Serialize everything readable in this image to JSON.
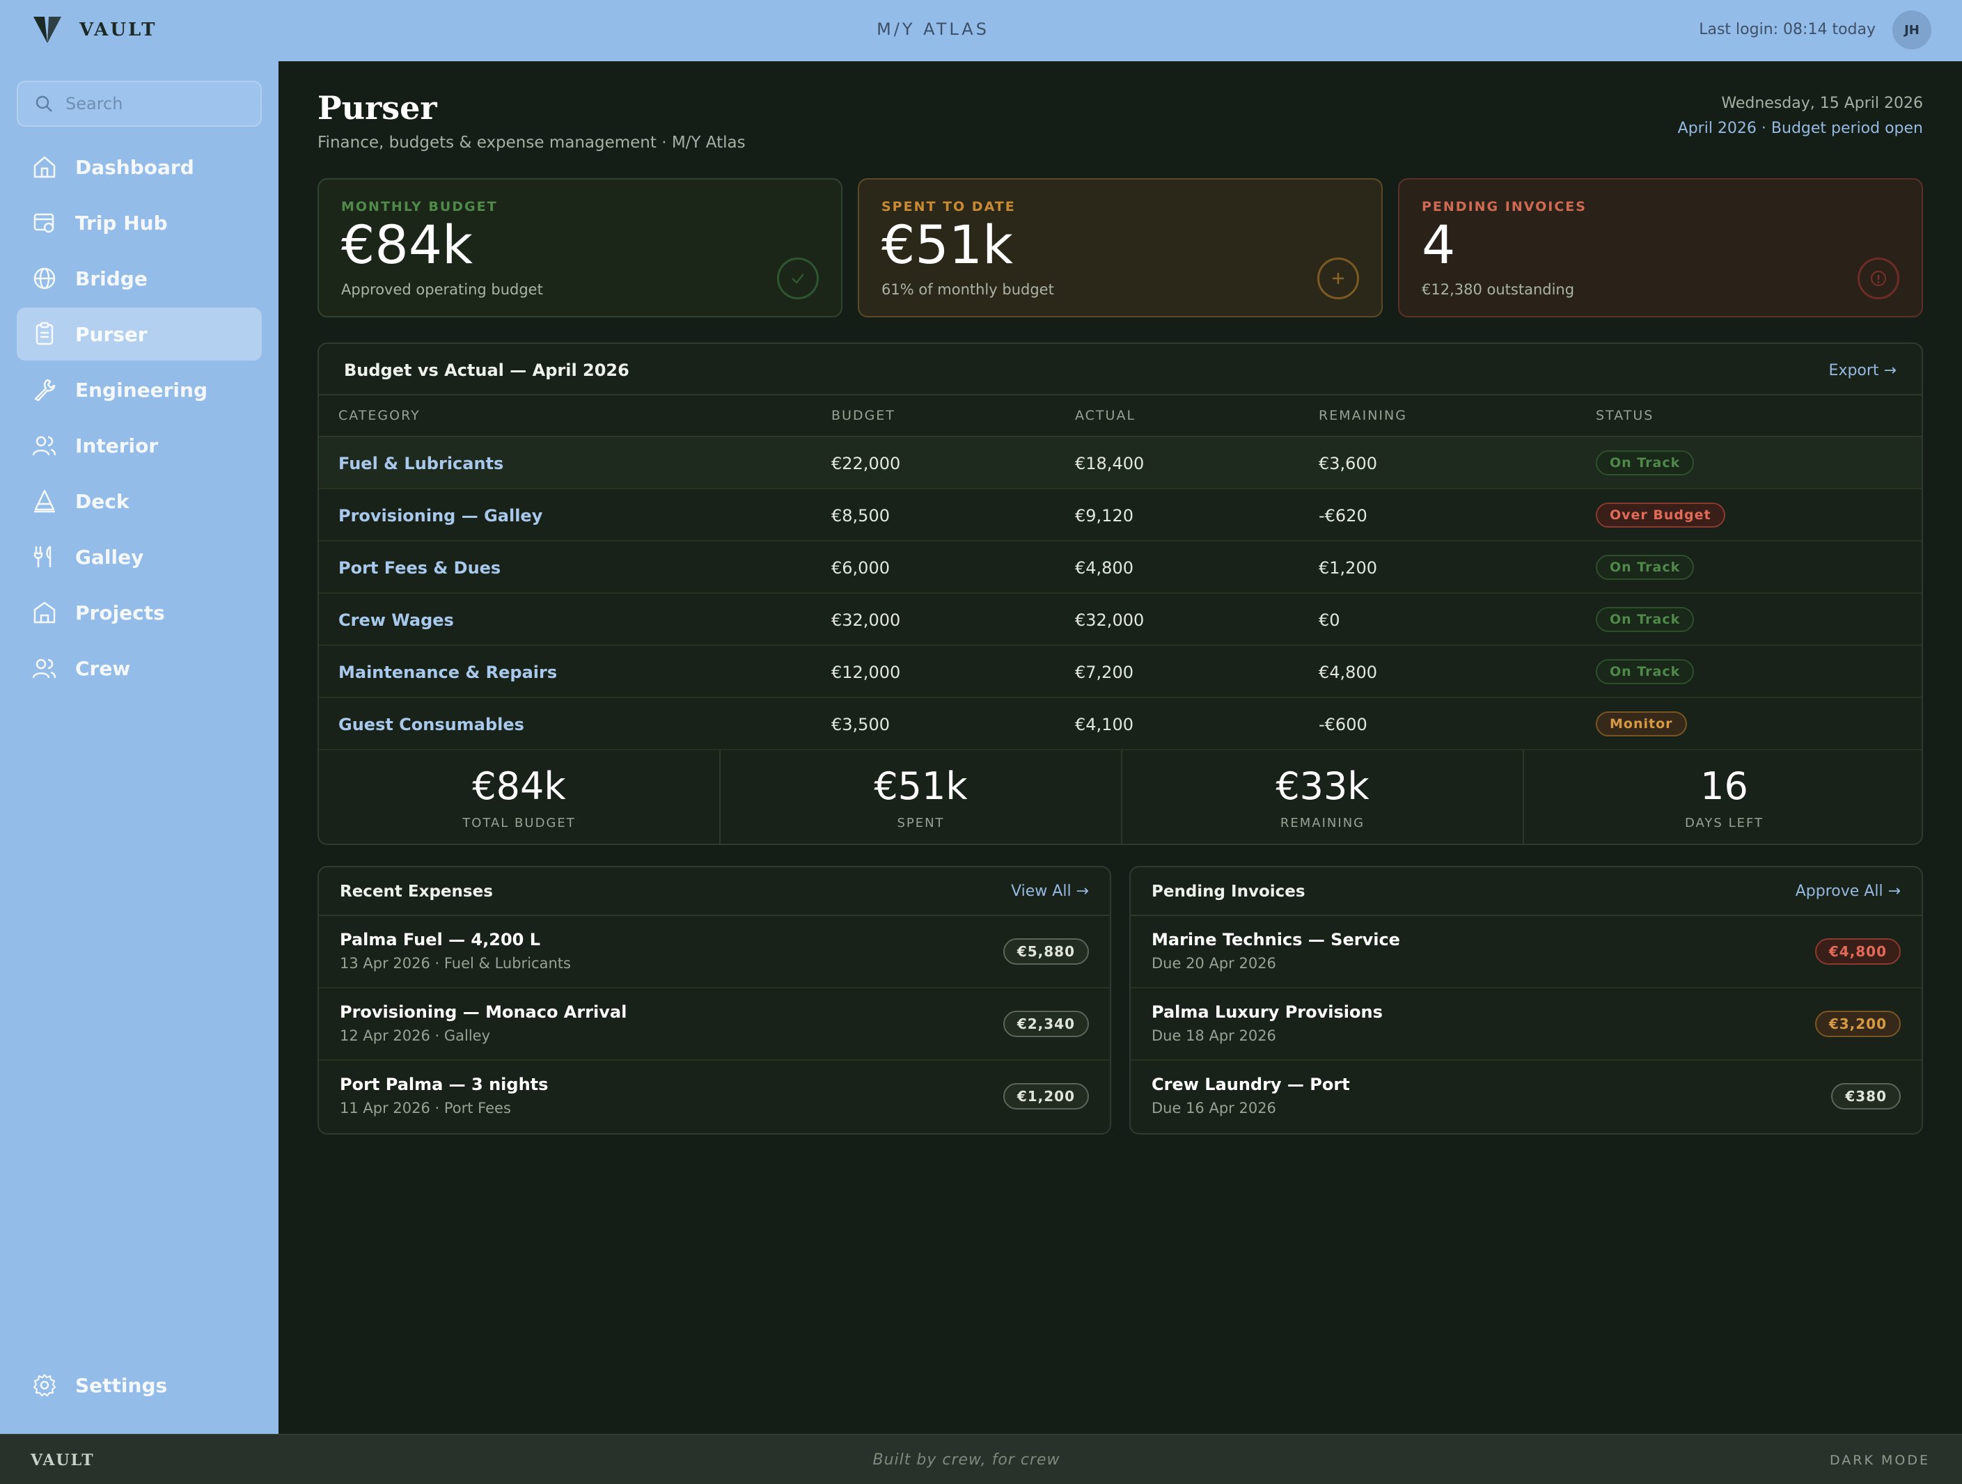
{
  "app": {
    "name": "VAULT",
    "vessel": "M/Y ATLAS",
    "last_login": "Last login: 08:14 today",
    "user_initials": "JH"
  },
  "sidebar": {
    "search_placeholder": "Search",
    "items": [
      {
        "label": "Dashboard",
        "icon": "home-icon"
      },
      {
        "label": "Trip Hub",
        "icon": "trip-hub-icon"
      },
      {
        "label": "Bridge",
        "icon": "globe-icon"
      },
      {
        "label": "Purser",
        "icon": "clipboard-icon",
        "active": true
      },
      {
        "label": "Engineering",
        "icon": "wrench-icon"
      },
      {
        "label": "Interior",
        "icon": "users-icon"
      },
      {
        "label": "Deck",
        "icon": "sail-icon"
      },
      {
        "label": "Galley",
        "icon": "utensils-icon"
      },
      {
        "label": "Projects",
        "icon": "building-icon"
      },
      {
        "label": "Crew",
        "icon": "users-icon"
      }
    ],
    "settings_label": "Settings"
  },
  "header": {
    "title": "Purser",
    "subtitle": "Finance, budgets & expense management · M/Y Atlas",
    "date": "Wednesday, 15 April 2026",
    "period": "April 2026 · Budget period open"
  },
  "stats": [
    {
      "label": "MONTHLY BUDGET",
      "value": "€84k",
      "sub": "Approved operating budget",
      "icon": "check-icon",
      "tone": "green"
    },
    {
      "label": "SPENT TO DATE",
      "value": "€51k",
      "sub": "61% of monthly budget",
      "icon": "plus-icon",
      "tone": "amber"
    },
    {
      "label": "PENDING INVOICES",
      "value": "4",
      "sub": "€12,380 outstanding",
      "icon": "info-icon",
      "tone": "red"
    }
  ],
  "budget_table": {
    "title": "Budget vs Actual — April 2026",
    "export_label": "Export →",
    "columns": [
      "CATEGORY",
      "BUDGET",
      "ACTUAL",
      "REMAINING",
      "STATUS"
    ],
    "rows": [
      {
        "category": "Fuel & Lubricants",
        "budget": "€22,000",
        "actual": "€18,400",
        "remaining": "€3,600",
        "status": "On Track",
        "tone": "ok"
      },
      {
        "category": "Provisioning — Galley",
        "budget": "€8,500",
        "actual": "€9,120",
        "remaining": "-€620",
        "status": "Over Budget",
        "tone": "over"
      },
      {
        "category": "Port Fees & Dues",
        "budget": "€6,000",
        "actual": "€4,800",
        "remaining": "€1,200",
        "status": "On Track",
        "tone": "ok"
      },
      {
        "category": "Crew Wages",
        "budget": "€32,000",
        "actual": "€32,000",
        "remaining": "€0",
        "status": "On Track",
        "tone": "ok"
      },
      {
        "category": "Maintenance & Repairs",
        "budget": "€12,000",
        "actual": "€7,200",
        "remaining": "€4,800",
        "status": "On Track",
        "tone": "ok"
      },
      {
        "category": "Guest Consumables",
        "budget": "€3,500",
        "actual": "€4,100",
        "remaining": "-€600",
        "status": "Monitor",
        "tone": "monitor"
      }
    ],
    "totals": [
      {
        "value": "€84k",
        "label": "TOTAL BUDGET"
      },
      {
        "value": "€51k",
        "label": "SPENT"
      },
      {
        "value": "€33k",
        "label": "REMAINING"
      },
      {
        "value": "16",
        "label": "DAYS LEFT"
      }
    ]
  },
  "recent_expenses": {
    "title": "Recent Expenses",
    "link": "View All →",
    "items": [
      {
        "title": "Palma Fuel — 4,200 L",
        "sub": "13 Apr 2026 · Fuel & Lubricants",
        "amount": "€5,880"
      },
      {
        "title": "Provisioning — Monaco Arrival",
        "sub": "12 Apr 2026 · Galley",
        "amount": "€2,340"
      },
      {
        "title": "Port Palma — 3 nights",
        "sub": "11 Apr 2026 · Port Fees",
        "amount": "€1,200"
      }
    ]
  },
  "pending_invoices": {
    "title": "Pending Invoices",
    "link": "Approve All →",
    "items": [
      {
        "title": "Marine Technics — Service",
        "sub": "Due 20 Apr 2026",
        "amount": "€4,800",
        "tone": "red"
      },
      {
        "title": "Palma Luxury Provisions",
        "sub": "Due 18 Apr 2026",
        "amount": "€3,200",
        "tone": "amber"
      },
      {
        "title": "Crew Laundry — Port",
        "sub": "Due 16 Apr 2026",
        "amount": "€380",
        "tone": "neutral"
      }
    ]
  },
  "footer": {
    "logo": "VAULT",
    "tagline": "Built by crew, for crew",
    "mode": "DARK MODE"
  }
}
